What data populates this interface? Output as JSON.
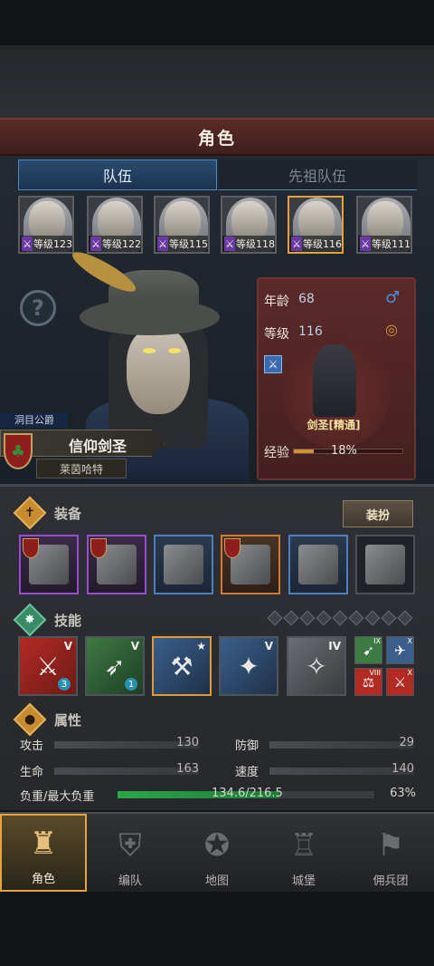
{
  "header": {
    "title": "角色"
  },
  "tabs": [
    {
      "label": "队伍",
      "active": true
    },
    {
      "label": "先祖队伍",
      "active": false
    }
  ],
  "roster": [
    {
      "level_text": "等级123",
      "selected": false
    },
    {
      "level_text": "等级122",
      "selected": false
    },
    {
      "level_text": "等级115",
      "selected": false
    },
    {
      "level_text": "等级118",
      "selected": false
    },
    {
      "level_text": "等级116",
      "selected": true
    },
    {
      "level_text": "等级111",
      "selected": false
    }
  ],
  "character": {
    "title": "洞目公爵",
    "name": "信仰剑圣",
    "region": "莱茵哈特",
    "age_label": "年龄",
    "age": "68",
    "level_label": "等级",
    "level": "116",
    "class_name": "剑圣[精通]",
    "exp_label": "经验",
    "exp_percent_text": "18%",
    "exp_fraction": 0.18
  },
  "equipment": {
    "title": "装备",
    "dress_button": "装扮",
    "slots": [
      {
        "name": "equip-slot-1",
        "rarity": "purple",
        "flag": true
      },
      {
        "name": "equip-slot-2",
        "rarity": "purple",
        "flag": true
      },
      {
        "name": "equip-slot-3",
        "rarity": "blue",
        "flag": false
      },
      {
        "name": "equip-slot-4",
        "rarity": "orange",
        "flag": true
      },
      {
        "name": "equip-slot-5",
        "rarity": "blue",
        "flag": false
      },
      {
        "name": "equip-slot-6",
        "rarity": "none",
        "flag": false
      }
    ]
  },
  "skills": {
    "title": "技能",
    "diamond_count": 9,
    "items": [
      {
        "color": "red",
        "rank": "V",
        "count": "3",
        "glyph": "⚔"
      },
      {
        "color": "green",
        "rank": "V",
        "count": "1",
        "glyph": "➶"
      },
      {
        "color": "blue",
        "rank": "★",
        "count": "",
        "glyph": "⚒"
      },
      {
        "color": "blue",
        "rank": "V",
        "count": "",
        "glyph": "✦"
      },
      {
        "color": "grey",
        "rank": "IV",
        "count": "",
        "glyph": "✧"
      }
    ],
    "minis": [
      {
        "color": "green",
        "rank": "IX",
        "glyph": "➹"
      },
      {
        "color": "blue",
        "rank": "X",
        "glyph": "✈"
      },
      {
        "color": "red",
        "rank": "VIII",
        "glyph": "⚖"
      },
      {
        "color": "red",
        "rank": "X",
        "glyph": "⚔"
      }
    ]
  },
  "attributes": {
    "title": "属性",
    "attack_label": "攻击",
    "attack": "130",
    "defense_label": "防御",
    "defense": "29",
    "hp_label": "生命",
    "hp": "163",
    "speed_label": "速度",
    "speed": "140",
    "load_label": "负重/最大负重",
    "load_text": "134.6/216.5",
    "load_percent_text": "63%",
    "load_fraction": 0.63
  },
  "nav": [
    {
      "label": "角色",
      "active": true,
      "icon": "character-icon",
      "glyph": "♜"
    },
    {
      "label": "编队",
      "active": false,
      "icon": "formation-icon",
      "glyph": "⛨"
    },
    {
      "label": "地图",
      "active": false,
      "icon": "map-icon",
      "glyph": "✪"
    },
    {
      "label": "城堡",
      "active": false,
      "icon": "castle-icon",
      "glyph": "♖"
    },
    {
      "label": "佣兵团",
      "active": false,
      "icon": "mercenary-icon",
      "glyph": "⚑"
    }
  ]
}
